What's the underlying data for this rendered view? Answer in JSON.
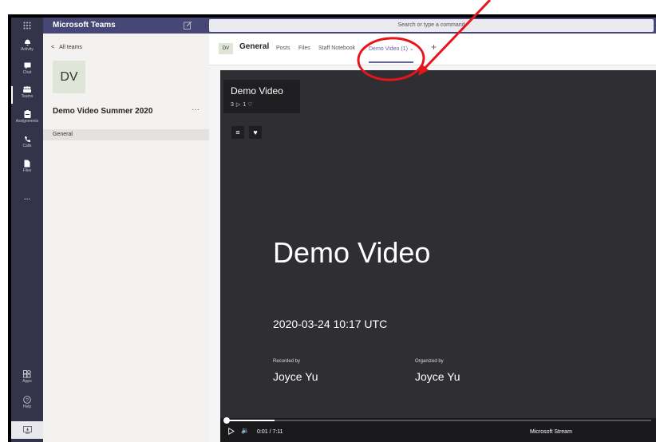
{
  "app": {
    "title": "Microsoft Teams"
  },
  "search": {
    "text": "Search or type a command"
  },
  "rail": {
    "items": [
      {
        "label": "Activity",
        "icon": "bell-icon"
      },
      {
        "label": "Chat",
        "icon": "chat-icon"
      },
      {
        "label": "Teams",
        "icon": "teams-icon"
      },
      {
        "label": "Assignments",
        "icon": "assignments-icon"
      },
      {
        "label": "Calls",
        "icon": "phone-icon"
      },
      {
        "label": "Files",
        "icon": "files-icon"
      },
      {
        "label": "...",
        "icon": "more-icon"
      },
      {
        "label": "Apps",
        "icon": "apps-icon"
      },
      {
        "label": "Help",
        "icon": "help-icon"
      }
    ]
  },
  "panel": {
    "back_label": "All teams",
    "team_initials": "DV",
    "team_name": "Demo Video Summer 2020",
    "more": "···",
    "channel": "General"
  },
  "channel_header": {
    "initials": "DV",
    "name": "General",
    "tabs": [
      "Posts",
      "Files",
      "Staff Notebook",
      "Demo Video (1)"
    ],
    "add": "+"
  },
  "player": {
    "title": "Demo Video",
    "views": "3",
    "likes": "1",
    "slide_title": "Demo Video",
    "slide_date": "2020-03-24 10:17 UTC",
    "recorded_label": "Recorded by",
    "recorded_value": "Joyce Yu",
    "organized_label": "Organized by",
    "organized_value": "Joyce Yu",
    "time": "0:01 / 7:11",
    "progress": 0.002,
    "brand": "Microsoft Stream"
  },
  "colors": {
    "rail": "#33344a",
    "topbar": "#464775",
    "accent": "#6264a7",
    "annotation": "#e8141b"
  }
}
